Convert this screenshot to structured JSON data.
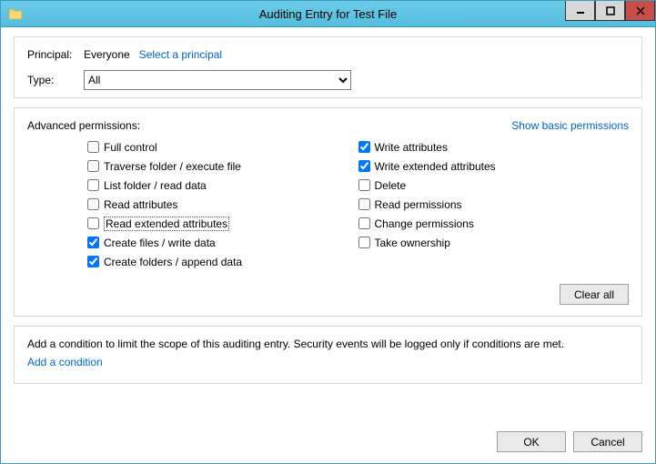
{
  "window": {
    "title": "Auditing Entry for Test File"
  },
  "header": {
    "principal_label": "Principal:",
    "principal_value": "Everyone",
    "select_principal": "Select a principal",
    "type_label": "Type:",
    "type_value": "All",
    "type_options": [
      "All"
    ]
  },
  "permissions": {
    "section_label": "Advanced permissions:",
    "show_basic": "Show basic permissions",
    "left": [
      {
        "label": "Full control",
        "checked": false
      },
      {
        "label": "Traverse folder / execute file",
        "checked": false
      },
      {
        "label": "List folder / read data",
        "checked": false
      },
      {
        "label": "Read attributes",
        "checked": false
      },
      {
        "label": "Read extended attributes",
        "checked": false,
        "focused": true
      },
      {
        "label": "Create files / write data",
        "checked": true
      },
      {
        "label": "Create folders / append data",
        "checked": true
      }
    ],
    "right": [
      {
        "label": "Write attributes",
        "checked": true
      },
      {
        "label": "Write extended attributes",
        "checked": true
      },
      {
        "label": "Delete",
        "checked": false
      },
      {
        "label": "Read permissions",
        "checked": false
      },
      {
        "label": "Change permissions",
        "checked": false
      },
      {
        "label": "Take ownership",
        "checked": false
      }
    ],
    "clear_all": "Clear all"
  },
  "condition": {
    "text": "Add a condition to limit the scope of this auditing entry. Security events will be logged only if conditions are met.",
    "add_link": "Add a condition"
  },
  "footer": {
    "ok": "OK",
    "cancel": "Cancel"
  }
}
